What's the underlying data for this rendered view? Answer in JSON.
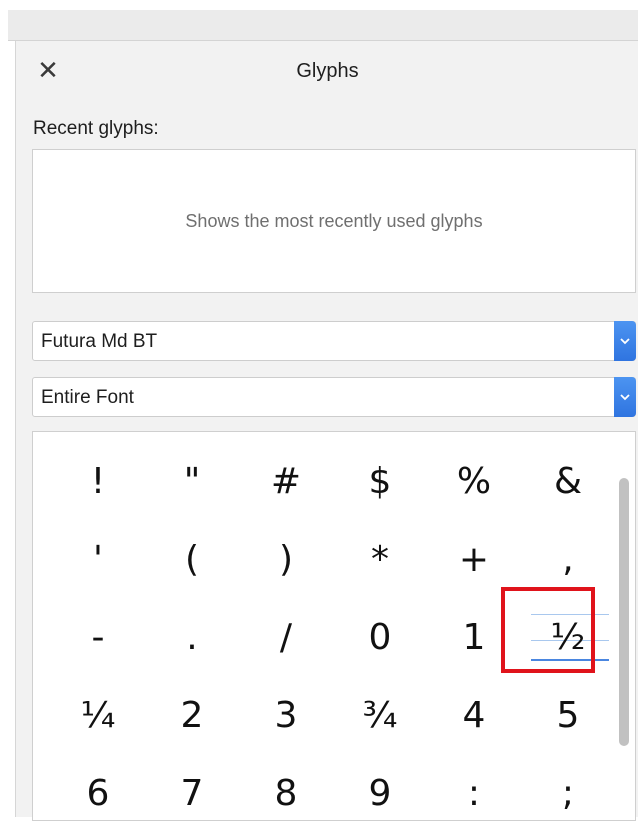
{
  "panel": {
    "title": "Glyphs",
    "close_symbol": "✕",
    "recent_label": "Recent glyphs:",
    "recent_placeholder": "Shows the most recently used glyphs"
  },
  "font_select": {
    "value": "Futura Md BT"
  },
  "range_select": {
    "value": "Entire Font"
  },
  "glyphs": [
    "!",
    "\"",
    "#",
    "$",
    "%",
    "&",
    "'",
    "(",
    ")",
    "*",
    "+",
    ",",
    "-",
    ".",
    "/",
    "0",
    "1",
    "½",
    "¼",
    "2",
    "3",
    "¾",
    "4",
    "5",
    "6",
    "7",
    "8",
    "9",
    ":",
    ";"
  ],
  "selected_glyph": "½",
  "colors": {
    "accent": "#2f74e0",
    "highlight": "#e0131b"
  }
}
